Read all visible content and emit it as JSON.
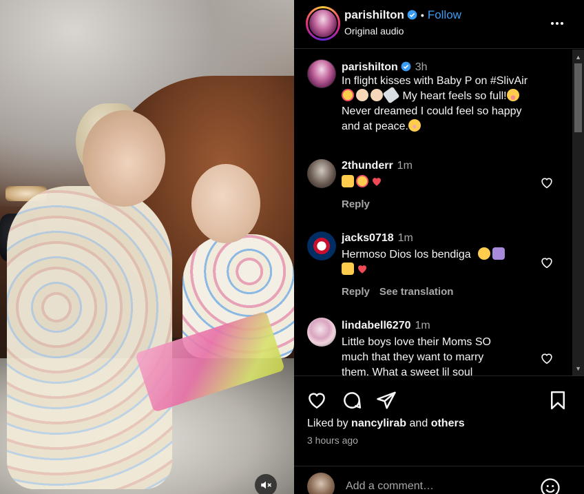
{
  "video": {
    "mute_icon": "speaker-muted-icon"
  },
  "header": {
    "username": "parishilton",
    "separator": "•",
    "follow_label": "Follow",
    "subtitle": "Original audio",
    "more_icon": "more-horizontal-icon"
  },
  "caption": {
    "username": "parishilton",
    "time": "3h",
    "lines": [
      "In flight kisses with Baby P on #SlivAir",
      "My heart feels so full!",
      "Never dreamed I could feel so happy",
      "and at peace."
    ]
  },
  "comments": [
    {
      "username": "2thunderr",
      "time": "1m",
      "text": "",
      "emojis": [
        "raising-hands",
        "smiling-face-with-hearts",
        "red-heart"
      ],
      "actions": [
        "Reply"
      ]
    },
    {
      "username": "jacks0718",
      "time": "1m",
      "text": "Hermoso Dios los bendiga",
      "emojis": [
        "grinning-face",
        "folded-hands",
        "heart-hands",
        "red-heart"
      ],
      "actions": [
        "Reply",
        "See translation"
      ]
    },
    {
      "username": "lindabell6270",
      "time": "1m",
      "lines": [
        "Little boys love their Moms SO",
        "much that they want to marry",
        "them. What a sweet lil soul"
      ]
    }
  ],
  "footer": {
    "liked_prefix": "Liked by",
    "liked_user": "nancylirab",
    "liked_and": "and",
    "liked_others": "others",
    "time_ago": "3 hours ago",
    "add_comment_placeholder": "Add a comment…"
  },
  "colors": {
    "accent": "#3b9cf3",
    "heart_red": "#ed4956",
    "muted_text": "#a8a8a8",
    "background": "#000000"
  }
}
